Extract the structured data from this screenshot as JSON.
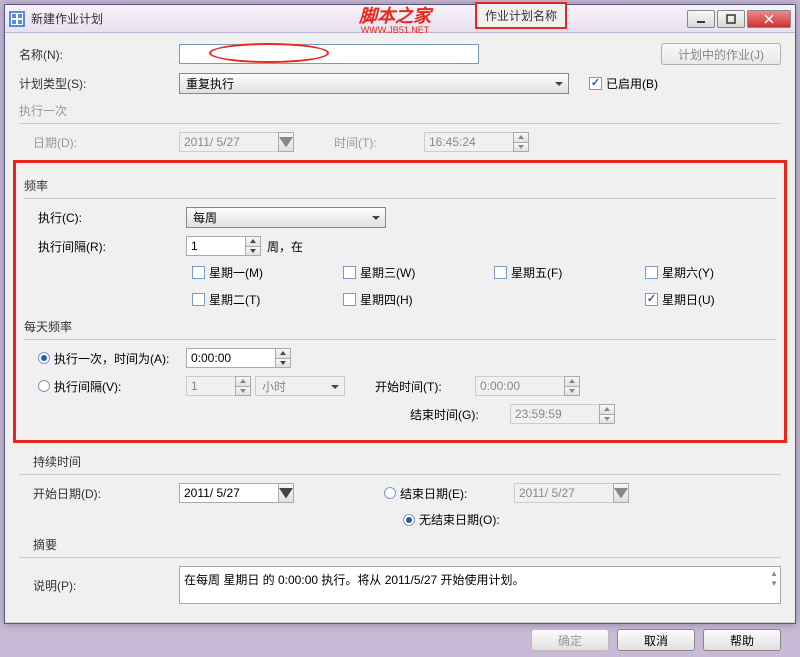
{
  "window": {
    "title": "新建作业计划"
  },
  "watermark": {
    "main": "脚本之家",
    "sub": "WWW.JB51.NET"
  },
  "annotation": {
    "text": "作业计划名称"
  },
  "fields": {
    "name_label": "名称(N):",
    "name_value": "",
    "jobs_button": "计划中的作业(J)",
    "type_label": "计划类型(S):",
    "type_value": "重复执行",
    "enabled_label": "已启用(B)"
  },
  "once": {
    "group": "执行一次",
    "date_label": "日期(D):",
    "date_value": "2011/ 5/27",
    "time_label": "时间(T):",
    "time_value": "16:45:24"
  },
  "freq": {
    "group": "频率",
    "exec_label": "执行(C):",
    "exec_value": "每周",
    "interval_label": "执行间隔(R):",
    "interval_value": "1",
    "interval_unit": "周，在",
    "days": {
      "mon": "星期一(M)",
      "tue": "星期二(T)",
      "wed": "星期三(W)",
      "thu": "星期四(H)",
      "fri": "星期五(F)",
      "sat": "星期六(Y)",
      "sun": "星期日(U)"
    }
  },
  "daily": {
    "group": "每天频率",
    "once_label": "执行一次，时间为(A):",
    "once_value": "0:00:00",
    "interval_label": "执行间隔(V):",
    "interval_value": "1",
    "interval_unit": "小时",
    "start_label": "开始时间(T):",
    "start_value": "0:00:00",
    "end_label": "结束时间(G):",
    "end_value": "23:59:59"
  },
  "duration": {
    "group": "持续时间",
    "start_label": "开始日期(D):",
    "start_value": "2011/ 5/27",
    "end_label": "结束日期(E):",
    "end_value": "2011/ 5/27",
    "noend_label": "无结束日期(O):"
  },
  "summary": {
    "group": "摘要",
    "desc_label": "说明(P):",
    "desc_value": "在每周 星期日 的 0:00:00 执行。将从 2011/5/27 开始使用计划。"
  },
  "buttons": {
    "ok": "确定",
    "cancel": "取消",
    "help": "帮助"
  }
}
